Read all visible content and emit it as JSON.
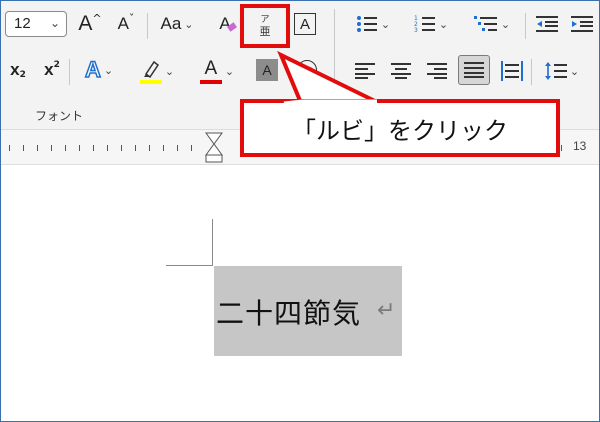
{
  "ribbon": {
    "font_size_value": "12",
    "group_label": "フォント",
    "row1": {
      "grow_font_glyph": "A",
      "shrink_font_glyph": "A",
      "change_case_label": "Aa",
      "clear_format_glyph": "A",
      "ruby_top": "ア",
      "ruby_base": "亜",
      "enclosed_char_glyph": "A"
    },
    "row2": {
      "subscript_base": "x",
      "subscript_mark": "2",
      "superscript_base": "x",
      "superscript_mark": "2",
      "text_effect_glyph": "A",
      "font_color_glyph": "A",
      "char_shading_glyph": "A",
      "enclose_glyph": "字"
    },
    "colors": {
      "highlight": "#ffff00",
      "font_color": "#e00000"
    }
  },
  "ruler": {
    "right_number": "13"
  },
  "callout": {
    "text": "「ルビ」をクリック"
  },
  "document": {
    "text": "二十四節気",
    "return_mark": "↵"
  },
  "accent_colors": {
    "annotation_red": "#e20c0c",
    "icon_blue": "#1e6fd0",
    "selection_gray": "#c6c6c6"
  }
}
